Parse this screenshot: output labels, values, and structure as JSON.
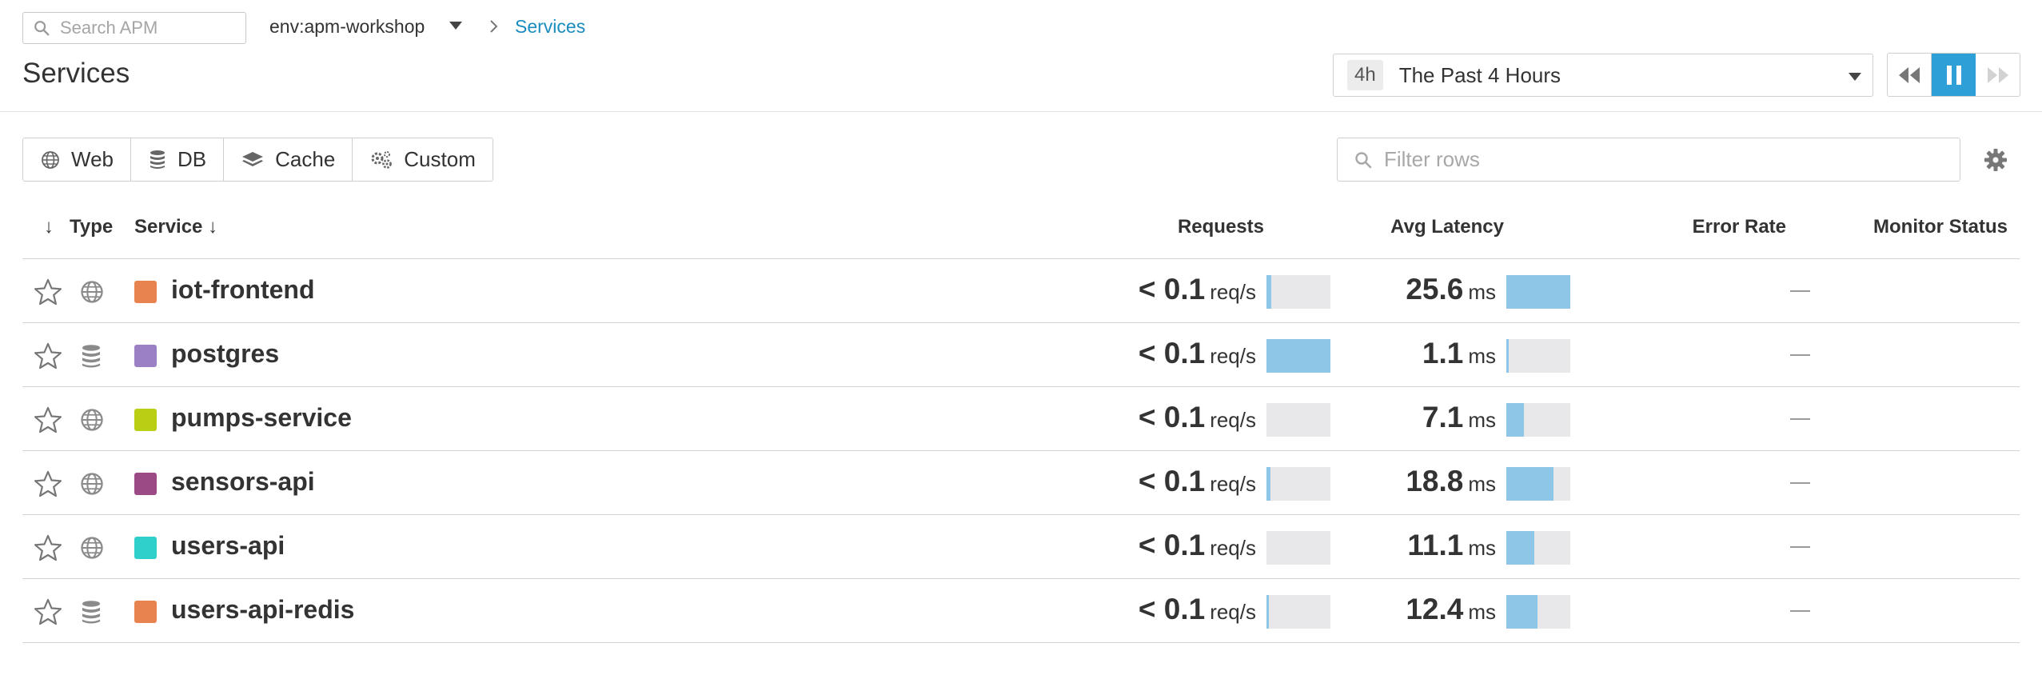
{
  "topbar": {
    "search_placeholder": "Search APM",
    "env": "env:apm-workshop",
    "breadcrumb_current": "Services"
  },
  "page_title": "Services",
  "timepicker": {
    "badge": "4h",
    "label": "The Past 4 Hours"
  },
  "type_filters": [
    {
      "label": "Web",
      "icon": "globe-icon"
    },
    {
      "label": "DB",
      "icon": "database-icon"
    },
    {
      "label": "Cache",
      "icon": "layers-icon"
    },
    {
      "label": "Custom",
      "icon": "gears-icon"
    }
  ],
  "filter_rows_placeholder": "Filter rows",
  "table": {
    "headers": {
      "sort_arrow": "↓",
      "type": "Type",
      "service": "Service ↓",
      "requests": "Requests",
      "avg_latency": "Avg Latency",
      "error_rate": "Error Rate",
      "monitor_status": "Monitor Status"
    },
    "rows": [
      {
        "type": "web",
        "color": "#e8834f",
        "service": "iot-frontend",
        "requests": "< 0.1",
        "requests_unit": "req/s",
        "requests_fraction": 0.08,
        "latency": "25.6",
        "latency_unit": "ms",
        "latency_fraction": 1.0,
        "error_rate": "—"
      },
      {
        "type": "db",
        "color": "#9b80c6",
        "service": "postgres",
        "requests": "< 0.1",
        "requests_unit": "req/s",
        "requests_fraction": 1.0,
        "latency": "1.1",
        "latency_unit": "ms",
        "latency_fraction": 0.04,
        "error_rate": "—"
      },
      {
        "type": "web",
        "color": "#b8cf14",
        "service": "pumps-service",
        "requests": "< 0.1",
        "requests_unit": "req/s",
        "requests_fraction": 0.0,
        "latency": "7.1",
        "latency_unit": "ms",
        "latency_fraction": 0.28,
        "error_rate": "—"
      },
      {
        "type": "web",
        "color": "#9b4a86",
        "service": "sensors-api",
        "requests": "< 0.1",
        "requests_unit": "req/s",
        "requests_fraction": 0.06,
        "latency": "18.8",
        "latency_unit": "ms",
        "latency_fraction": 0.74,
        "error_rate": "—"
      },
      {
        "type": "web",
        "color": "#2fcfcb",
        "service": "users-api",
        "requests": "< 0.1",
        "requests_unit": "req/s",
        "requests_fraction": 0.0,
        "latency": "11.1",
        "latency_unit": "ms",
        "latency_fraction": 0.44,
        "error_rate": "—"
      },
      {
        "type": "db",
        "color": "#e8834f",
        "service": "users-api-redis",
        "requests": "< 0.1",
        "requests_unit": "req/s",
        "requests_fraction": 0.03,
        "latency": "12.4",
        "latency_unit": "ms",
        "latency_fraction": 0.49,
        "error_rate": "—"
      }
    ]
  }
}
